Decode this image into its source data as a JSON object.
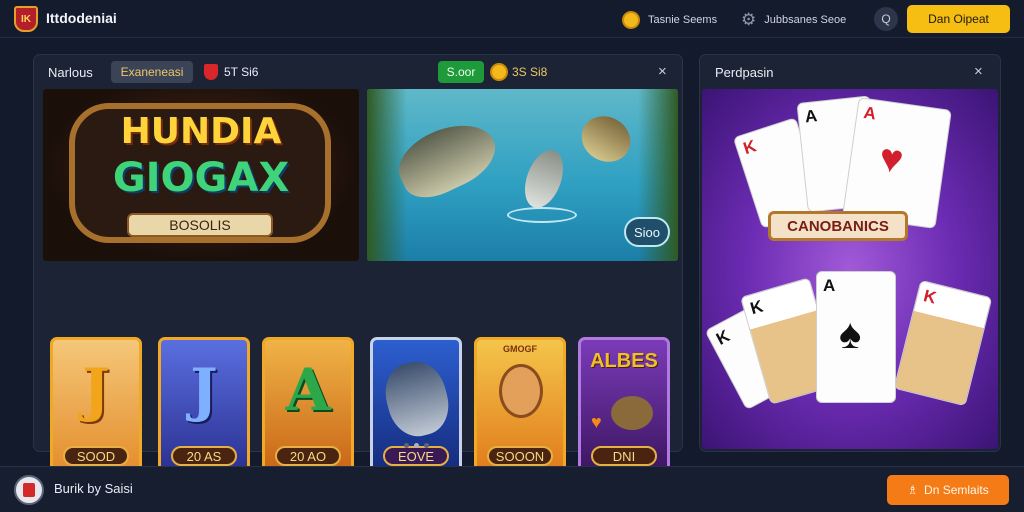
{
  "header": {
    "brand": "Ittdodeniai",
    "logo_text": "IK",
    "nav": [
      {
        "label": "Tasnie Seems",
        "icon": "coin-icon"
      },
      {
        "label": "Jubbsanes Seoe",
        "icon": "gear-icon"
      }
    ],
    "search_icon": "Q",
    "signup_label": "Dan Oipeat"
  },
  "left_panel": {
    "title": "Narlous",
    "tab": "Exaneneasi",
    "status": "5T Si6",
    "badge": "S.oor",
    "coins": "3S Si8",
    "close": "×",
    "banner1": {
      "line1": "HUNDIA",
      "line2": "GIOGAX",
      "plaque": "BOSOLIS"
    },
    "banner2": {
      "button": "Sioo"
    },
    "games": [
      {
        "letter": "J",
        "plate": "SOOD"
      },
      {
        "letter": "J",
        "plate": "20 AS"
      },
      {
        "letter": "A",
        "plate": "20 AO"
      },
      {
        "letter": "",
        "plate": "EOVE"
      },
      {
        "letter": "",
        "plate": "SOOON",
        "sign": "GMOGF"
      },
      {
        "letter": "ALBES",
        "plate": "DNI"
      }
    ]
  },
  "right_panel": {
    "title": "Perdpasin",
    "close": "×",
    "banner_label": "CANOBANICS",
    "cards": [
      {
        "rank": "A",
        "suit": "♠"
      },
      {
        "rank": "K",
        "suit": "♥"
      },
      {
        "rank": "A",
        "suit": "♥"
      },
      {
        "rank": "K",
        "suit": "♠"
      },
      {
        "rank": "A",
        "suit": "♠"
      },
      {
        "rank": "K",
        "suit": "♥"
      }
    ]
  },
  "footer": {
    "label": "Burik by Saisi",
    "cta_icon": "♗",
    "cta_label": "Dn Semlaits"
  },
  "colors": {
    "accent_yellow": "#f6bd12",
    "accent_orange": "#f47b16",
    "panel": "#1b2335",
    "purple": "#6b2bb2"
  }
}
